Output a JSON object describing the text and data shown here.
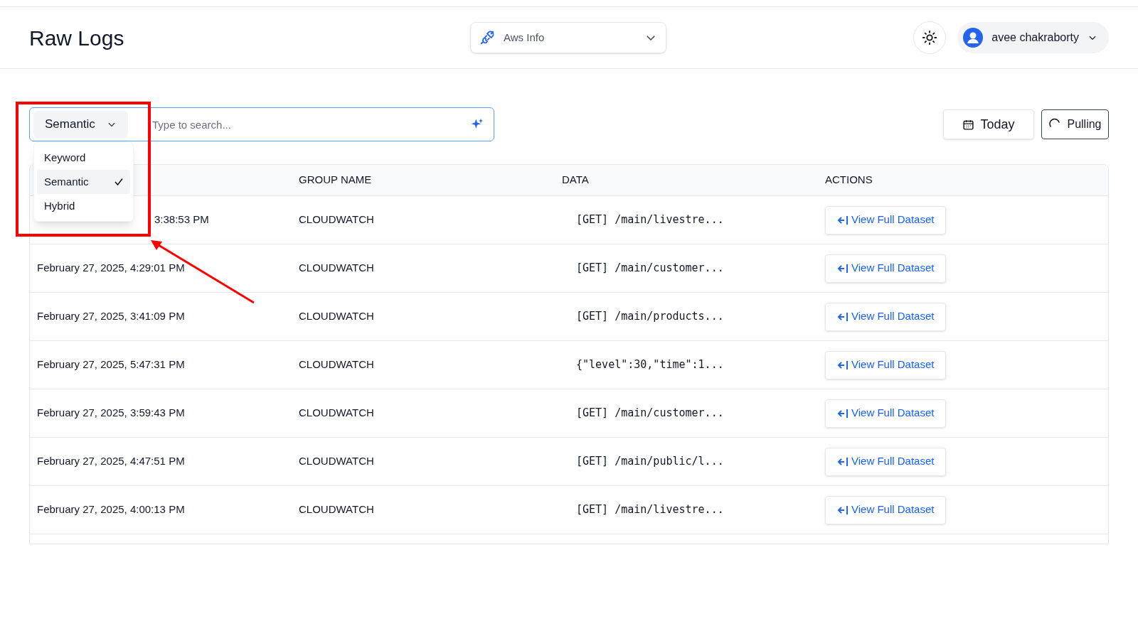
{
  "header": {
    "title": "Raw Logs",
    "source_select": {
      "value": "Aws Info"
    },
    "user": {
      "name": "avee chakraborty"
    }
  },
  "search": {
    "mode": "Semantic",
    "placeholder": "Type to search...",
    "mode_menu": [
      {
        "label": "Keyword",
        "selected": false
      },
      {
        "label": "Semantic",
        "selected": true
      },
      {
        "label": "Hybrid",
        "selected": false
      }
    ]
  },
  "date_button": "Today",
  "pulling_button": "Pulling",
  "table": {
    "columns": [
      "GROUP NAME",
      "DATA",
      "ACTIONS"
    ],
    "rows": [
      {
        "timestamp": "3:38:53 PM",
        "group": "CLOUDWATCH",
        "data": "[GET] /main/livestre...",
        "action": "View Full Dataset"
      },
      {
        "timestamp": "February 27, 2025, 4:29:01 PM",
        "group": "CLOUDWATCH",
        "data": "[GET] /main/customer...",
        "action": "View Full Dataset"
      },
      {
        "timestamp": "February 27, 2025, 3:41:09 PM",
        "group": "CLOUDWATCH",
        "data": "[GET] /main/products...",
        "action": "View Full Dataset"
      },
      {
        "timestamp": "February 27, 2025, 5:47:31 PM",
        "group": "CLOUDWATCH",
        "data": "{\"level\":30,\"time\":1...",
        "action": "View Full Dataset"
      },
      {
        "timestamp": "February 27, 2025, 3:59:43 PM",
        "group": "CLOUDWATCH",
        "data": "[GET] /main/customer...",
        "action": "View Full Dataset"
      },
      {
        "timestamp": "February 27, 2025, 4:47:51 PM",
        "group": "CLOUDWATCH",
        "data": "[GET] /main/public/l...",
        "action": "View Full Dataset"
      },
      {
        "timestamp": "February 27, 2025, 4:00:13 PM",
        "group": "CLOUDWATCH",
        "data": "[GET] /main/livestre...",
        "action": "View Full Dataset"
      }
    ]
  }
}
